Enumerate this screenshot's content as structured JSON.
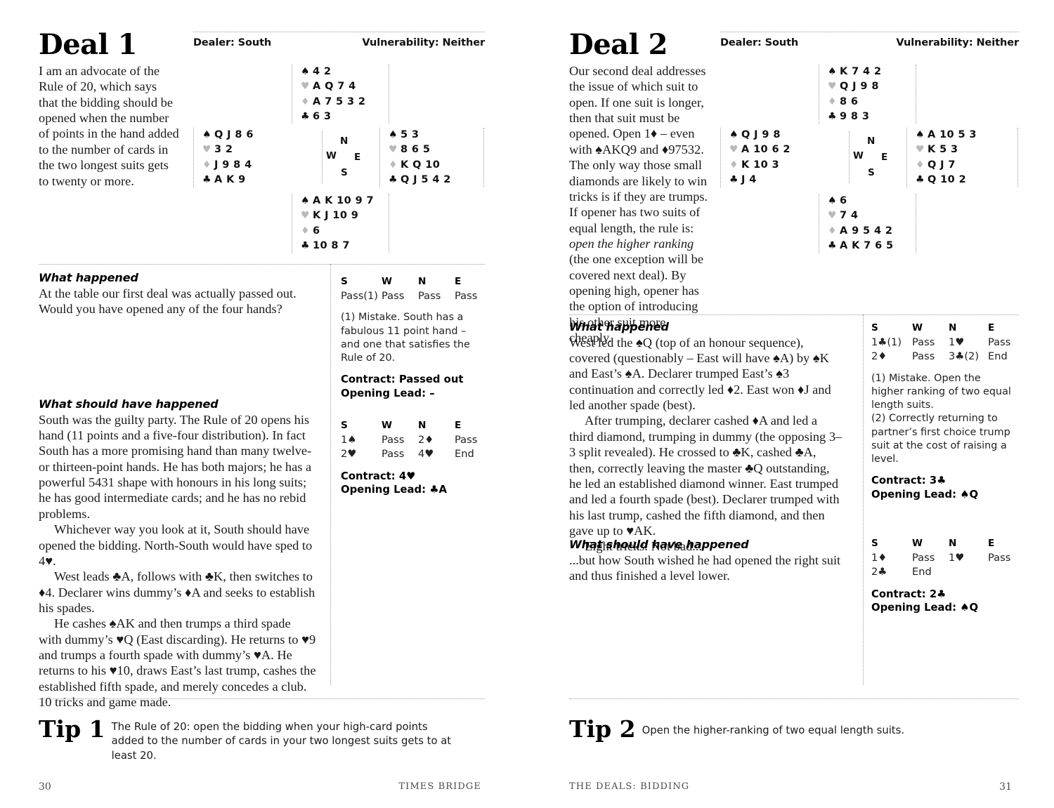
{
  "spread": {
    "left_page": {
      "deal": {
        "title": "Deal 1",
        "dealer": "Dealer: South",
        "vulnerability": "Vulnerability: Neither",
        "intro": "I am an advocate of the Rule of 20, which says that the bidding should be opened when the number of points in the hand added to the number of cards in the two longest suits gets to twenty or more.",
        "hands": {
          "north": {
            "spades": "4 2",
            "hearts": "A Q 7 4",
            "diamonds": "A 7 5 3 2",
            "clubs": "6 3"
          },
          "west": {
            "spades": "Q J 8 6",
            "hearts": "3 2",
            "diamonds": "J 9 8 4",
            "clubs": "A K 9"
          },
          "east": {
            "spades": "5 3",
            "hearts": "8 6 5",
            "diamonds": "K Q 10",
            "clubs": "Q J 5 4 2"
          },
          "south": {
            "spades": "A K 10 9 7",
            "hearts": "K J 10 9",
            "diamonds": "6",
            "clubs": "10 8 7"
          }
        },
        "compass": {
          "n": "N",
          "w": "W",
          "e": "E",
          "s": "S"
        }
      },
      "what_happened": {
        "heading": "What happened",
        "paragraphs": [
          "At the table our first deal was actually passed out. Would you have opened any of the four hands?"
        ]
      },
      "what_should": {
        "heading": "What should have happened",
        "paragraphs": [
          "South was the guilty party. The Rule of 20 opens his hand (11 points and a five-four distribution). In fact South has a more promising hand than many twelve- or thirteen-point hands. He has both majors; he has a powerful 5431 shape with honours in his long suits; he has good intermediate cards; and he has no rebid problems.",
          "Whichever way you look at it, South should have opened the bidding. North-South would have sped to 4♥.",
          "West leads ♣A, follows with ♣K, then switches to ♦4. Declarer wins dummy’s ♦A and seeks to establish his spades.",
          "He cashes ♠AK and then trumps a third spade with dummy’s ♥Q (East discarding). He returns to ♥9 and trumps a fourth spade with dummy’s ♥A. He returns to his ♥10, draws East’s last trump, cashes the established fifth spade, and merely concedes a club. 10 tricks and game made."
        ]
      },
      "auction_one": {
        "headers": [
          "S",
          "W",
          "N",
          "E"
        ],
        "rows": [
          [
            "Pass(1)",
            "Pass",
            "Pass",
            "Pass"
          ]
        ],
        "note": "(1) Mistake. South has a fabulous 11 point hand – and one that satisfies the Rule of 20.",
        "contract_label": "Contract: Passed out",
        "lead_label": "Opening Lead: –"
      },
      "auction_two": {
        "headers": [
          "S",
          "W",
          "N",
          "E"
        ],
        "rows": [
          [
            "1♠",
            "Pass",
            "2♦",
            "Pass"
          ],
          [
            "2♥",
            "Pass",
            "4♥",
            "End"
          ]
        ],
        "contract_label": "Contract: 4♥",
        "lead_label": "Opening Lead: ♣A"
      },
      "tip": {
        "label": "Tip 1",
        "text": "The Rule of 20: open the bidding when your high-card points added to the number of cards in your two longest suits gets to at least 20."
      },
      "footer": {
        "left": "30",
        "right": "TIMES BRIDGE"
      }
    },
    "right_page": {
      "deal": {
        "title": "Deal 2",
        "dealer": "Dealer: South",
        "vulnerability": "Vulnerability: Neither",
        "intro_pre": "Our second deal addresses the issue of which suit to open. If one suit is longer, then that suit must be opened. Open 1♦ – even with ♠AKQ9 and ♦97532. The only way those small diamonds are likely to win tricks is if they are trumps. If opener has two suits of equal length, the rule is:",
        "intro_em": "open the higher ranking",
        "intro_post": "(the one exception will be covered next deal). By opening high, opener has the option of introducing his other suit more cheaply.",
        "hands": {
          "north": {
            "spades": "K 7 4 2",
            "hearts": "Q J 9 8",
            "diamonds": "8 6",
            "clubs": "9 8 3"
          },
          "west": {
            "spades": "Q J 9 8",
            "hearts": "A 10 6 2",
            "diamonds": "K 10 3",
            "clubs": "J 4"
          },
          "east": {
            "spades": "A 10 5 3",
            "hearts": "K 5 3",
            "diamonds": "Q J 7",
            "clubs": "Q 10 2"
          },
          "south": {
            "spades": "6",
            "hearts": "7 4",
            "diamonds": "A 9 5 4 2",
            "clubs": "A K 7 6 5"
          }
        },
        "compass": {
          "n": "N",
          "w": "W",
          "e": "E",
          "s": "S"
        }
      },
      "what_happened": {
        "heading": "What happened",
        "paragraphs": [
          "West led the ♠Q (top of an honour sequence), covered (questionably – East will have ♠A) by ♠K and East’s ♠A. Declarer trumped East’s ♠3 continuation and correctly led ♦2. East won ♦J and led another spade (best).",
          "After trumping, declarer cashed ♦A and led a third diamond, trumping in dummy (the opposing 3–3 split revealed). He crossed to ♣K, cashed ♣A, then, correctly leaving the master ♣Q outstanding, he led an established diamond winner. East trumped and led a fourth spade (best). Declarer trumped with his last trump, cashed the fifth diamond, and then gave up to ♥AK.",
          "Eight tricks. Not bad..."
        ]
      },
      "what_should": {
        "heading": "What should have happened",
        "paragraphs": [
          "...but how South wished he had opened the right suit and thus finished a level lower."
        ]
      },
      "auction_one": {
        "headers": [
          "S",
          "W",
          "N",
          "E"
        ],
        "rows": [
          [
            "1♣(1)",
            "Pass",
            "1♥",
            "Pass"
          ],
          [
            "2♦",
            "Pass",
            "3♣(2)",
            "End"
          ]
        ],
        "note1": "(1) Mistake. Open the higher ranking of two equal length suits.",
        "note2": "(2) Correctly returning to partner’s first choice trump suit at the cost of raising a level.",
        "contract_label": "Contract: 3♣",
        "lead_label": "Opening Lead: ♠Q"
      },
      "auction_two": {
        "headers": [
          "S",
          "W",
          "N",
          "E"
        ],
        "rows": [
          [
            "1♦",
            "Pass",
            "1♥",
            "Pass"
          ],
          [
            "2♣",
            "End",
            "",
            ""
          ]
        ],
        "contract_label": "Contract: 2♣",
        "lead_label": "Opening Lead: ♠Q"
      },
      "tip": {
        "label": "Tip 2",
        "text": "Open the higher-ranking of two equal length suits."
      },
      "footer": {
        "left": "THE DEALS: BIDDING",
        "right": "31"
      }
    }
  },
  "suits": {
    "spade": "♠",
    "heart": "♥",
    "diamond": "♦",
    "club": "♣"
  },
  "colors": {
    "ink": "#111111",
    "muted_suit": "#b9b9b9",
    "rule": "#9a9a9a",
    "footer": "#4a4a4a"
  }
}
